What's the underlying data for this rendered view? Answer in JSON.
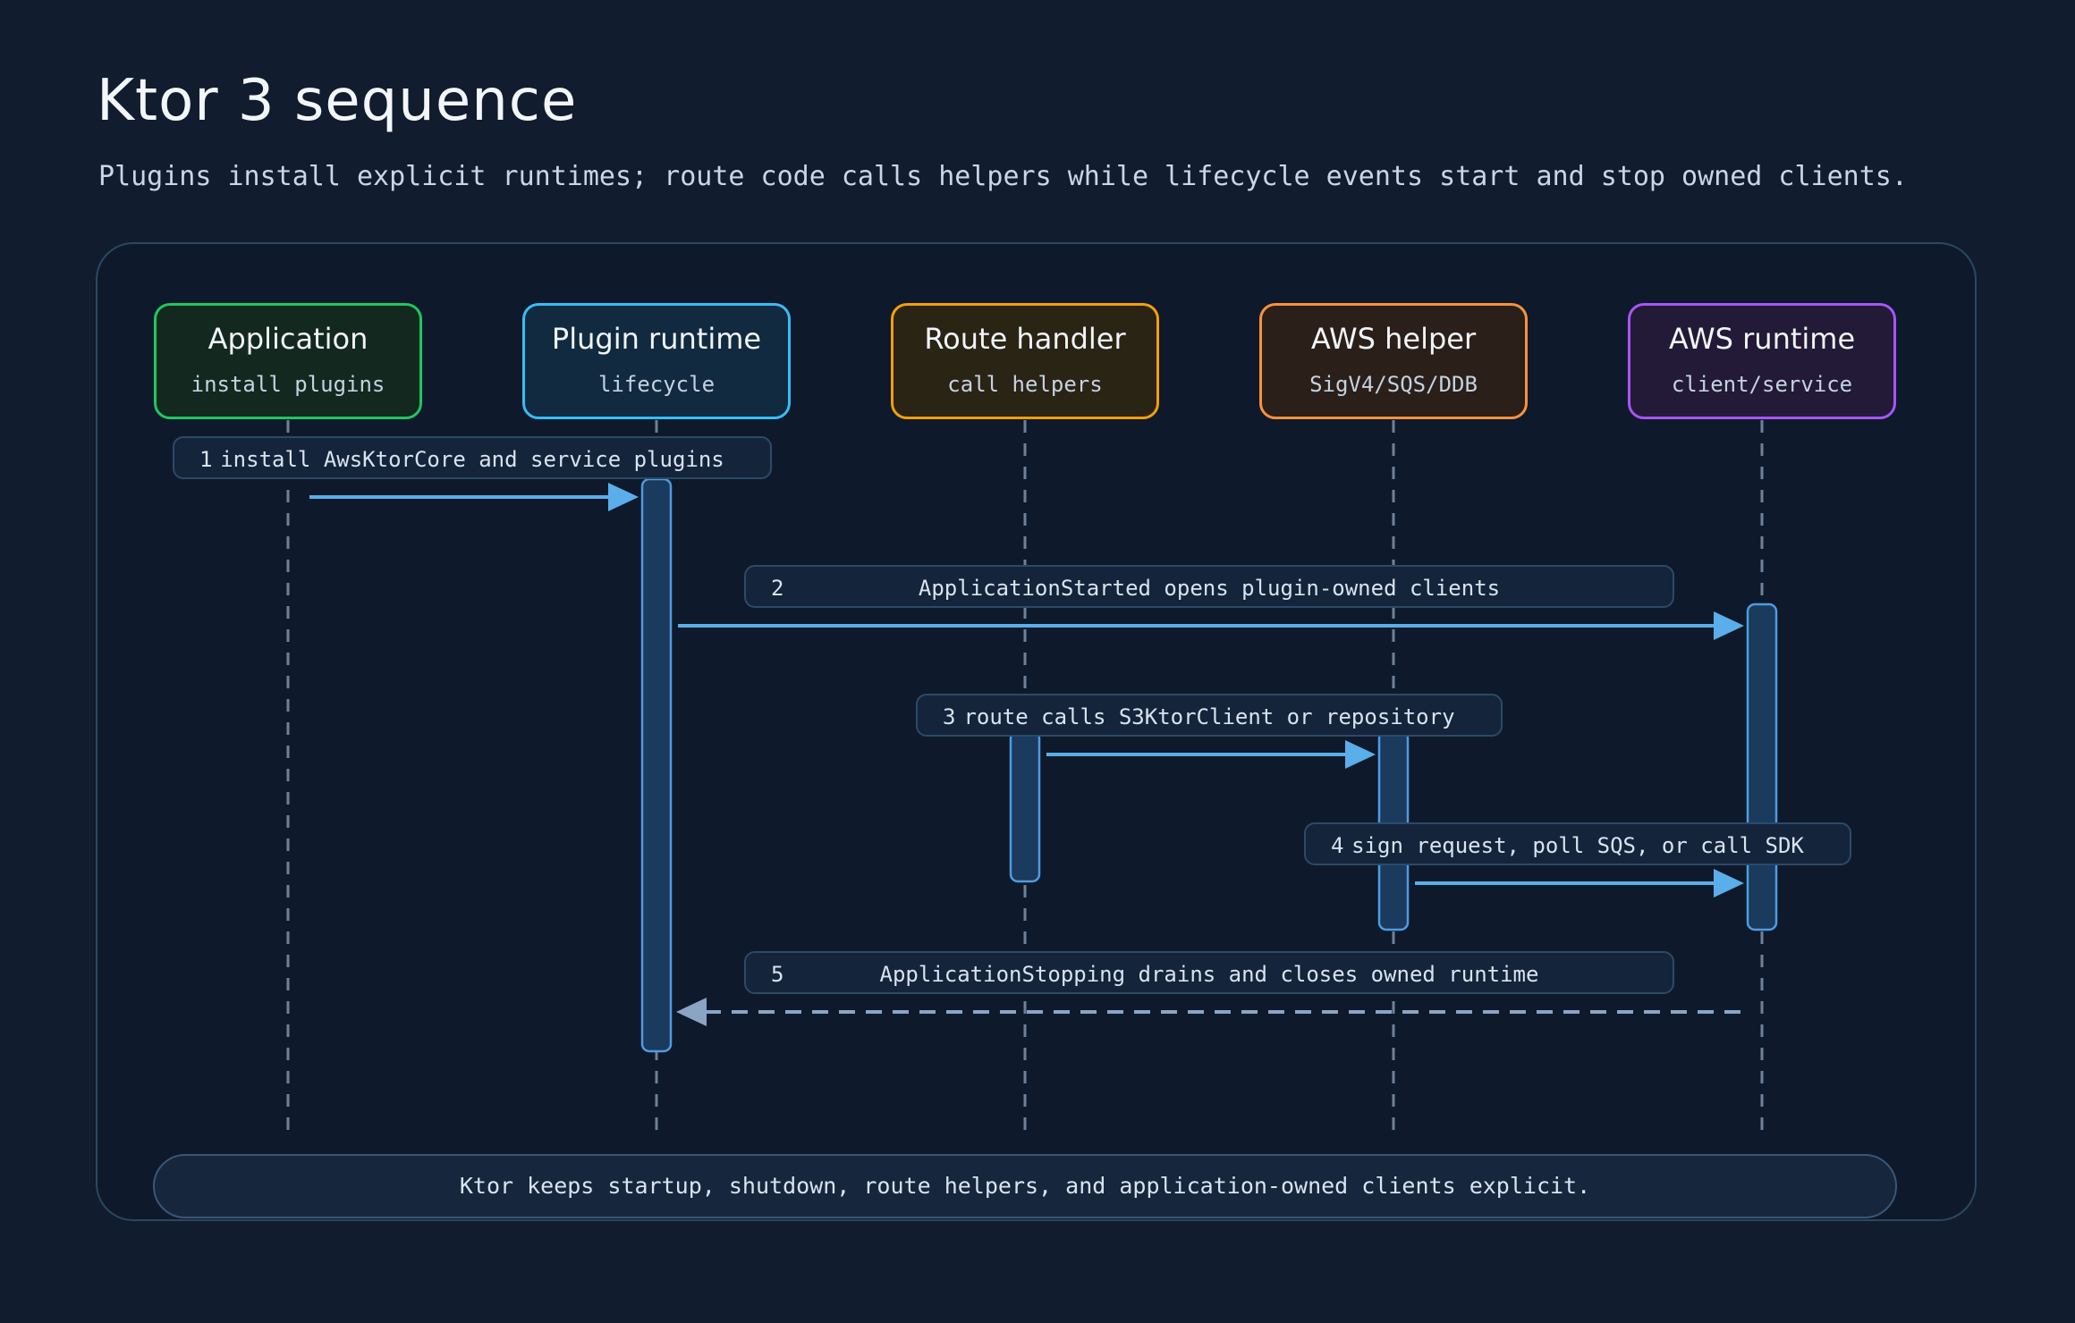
{
  "title": "Ktor 3 sequence",
  "subtitle": "Plugins install explicit runtimes; route code calls helpers while lifecycle events start and stop owned clients.",
  "actors": [
    {
      "name": "Application",
      "sub": "install plugins",
      "border": "#22c55e",
      "fill": "#13291f"
    },
    {
      "name": "Plugin runtime",
      "sub": "lifecycle",
      "border": "#38bdf8",
      "fill": "#112a40"
    },
    {
      "name": "Route handler",
      "sub": "call helpers",
      "border": "#f59e0b",
      "fill": "#2a2415"
    },
    {
      "name": "AWS helper",
      "sub": "SigV4/SQS/DDB",
      "border": "#fb923c",
      "fill": "#2a2019"
    },
    {
      "name": "AWS runtime",
      "sub": "client/service",
      "border": "#a855f7",
      "fill": "#221a36"
    }
  ],
  "steps": [
    {
      "num": "1",
      "text": "install AwsKtorCore and service plugins"
    },
    {
      "num": "2",
      "text": "ApplicationStarted opens plugin-owned clients"
    },
    {
      "num": "3",
      "text": "route calls S3KtorClient or repository"
    },
    {
      "num": "4",
      "text": "sign request, poll SQS, or call SDK"
    },
    {
      "num": "5",
      "text": "ApplicationStopping drains and closes owned runtime"
    }
  ],
  "footer": "Ktor keeps startup, shutdown, route helpers, and application-owned clients explicit.",
  "colors": {
    "arrow": "#5aaeea",
    "return_arrow": "#8aa4c4",
    "activation_fill": "#1a3a5e",
    "activation_stroke": "#4f9be0",
    "lifeline": "#6e8199"
  }
}
